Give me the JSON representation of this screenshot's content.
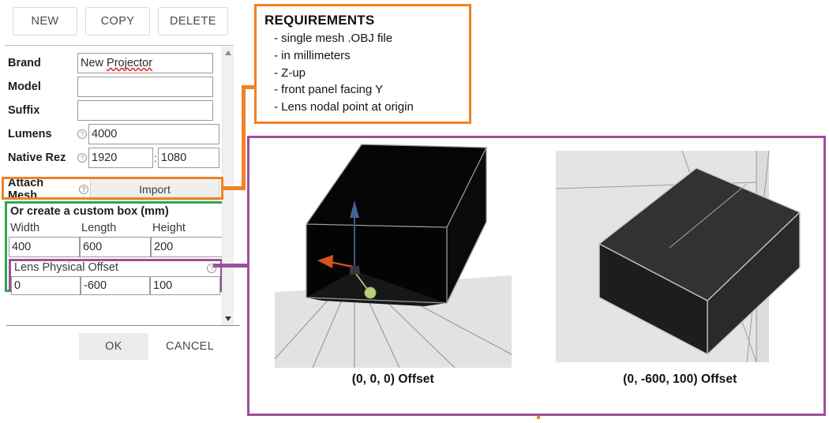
{
  "toolbar": {
    "new_label": "NEW",
    "copy_label": "COPY",
    "delete_label": "DELETE"
  },
  "form": {
    "fields": [
      {
        "label": "Brand",
        "value": "New Projector",
        "has_help": false
      },
      {
        "label": "Model",
        "value": "",
        "has_help": false
      },
      {
        "label": "Suffix",
        "value": "",
        "has_help": false
      },
      {
        "label": "Lumens",
        "value": "4000",
        "has_help": true
      }
    ],
    "native_rez": {
      "label": "Native Rez",
      "has_help": true,
      "width_value": "1920",
      "separator": ":",
      "height_value": "1080"
    },
    "attach_mesh": {
      "label": "Attach Mesh",
      "has_help": true,
      "import_label": "Import"
    },
    "custom_box": {
      "title": "Or create a custom box (mm)",
      "columns": [
        "Width",
        "Length",
        "Height"
      ],
      "values": [
        "400",
        "600",
        "200"
      ]
    },
    "lens_offset": {
      "title": "Lens Physical Offset",
      "has_help": true,
      "values": [
        "0",
        "-600",
        "100"
      ]
    },
    "ok_label": "OK",
    "cancel_label": "CANCEL"
  },
  "requirements": {
    "title": "REQUIREMENTS",
    "items": [
      "- single mesh .OBJ file",
      "- in millimeters",
      "- Z-up",
      "- front panel facing Y",
      "- Lens nodal point at origin"
    ]
  },
  "viewports": [
    {
      "caption": "(0, 0, 0) Offset"
    },
    {
      "caption": "(0, -600, 100) Offset"
    }
  ],
  "colors": {
    "orange_annotation": "#ef8325",
    "green_annotation": "#2aa84f",
    "purple_annotation": "#9b4f9b",
    "axis_z_blue": "#46628f",
    "axis_x_orange": "#d9521e",
    "axis_y_green": "#b9d17a",
    "box_black": "#040404",
    "box_gray": "#2b2b2b",
    "ground_gray": "#e2e2e2",
    "grid_line": "#8f8f8f"
  }
}
